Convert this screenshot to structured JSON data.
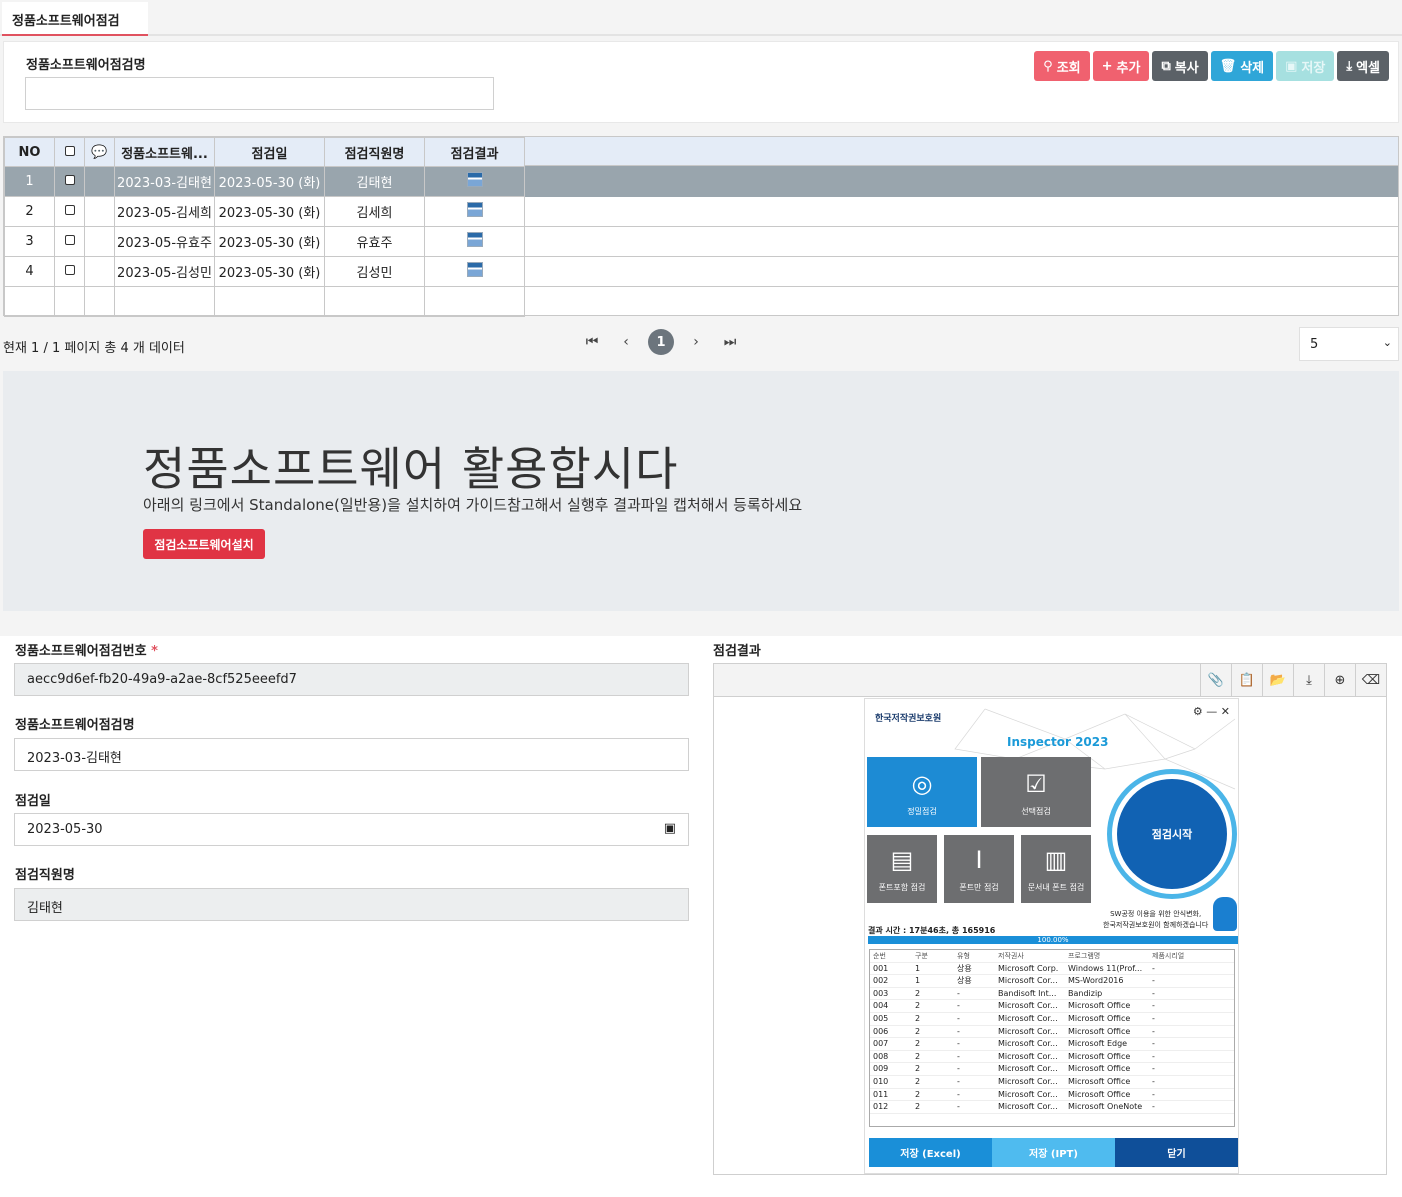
{
  "tab": {
    "label": "정품소프트웨어점검"
  },
  "search": {
    "label": "정품소프트웨어점검명",
    "value": ""
  },
  "toolbar": {
    "search": "조회",
    "add": "추가",
    "copy": "복사",
    "delete": "삭제",
    "save": "저장",
    "excel": "엑셀"
  },
  "grid": {
    "headers": [
      "NO",
      "",
      "",
      "정품소프트웨...",
      "점검일",
      "점검직원명",
      "점검결과"
    ],
    "rows": [
      {
        "no": "1",
        "name": "2023-03-김태현",
        "date": "2023-05-30 (화)",
        "staff": "김태현"
      },
      {
        "no": "2",
        "name": "2023-05-김세희",
        "date": "2023-05-30 (화)",
        "staff": "김세희"
      },
      {
        "no": "3",
        "name": "2023-05-유효주",
        "date": "2023-05-30 (화)",
        "staff": "유효주"
      },
      {
        "no": "4",
        "name": "2023-05-김성민",
        "date": "2023-05-30 (화)",
        "staff": "김성민"
      }
    ]
  },
  "paging": {
    "info": "현재 1 / 1 페이지 총 4 개 데이터",
    "current": "1",
    "page_size": "5"
  },
  "hero": {
    "title": "정품소프트웨어 활용합시다",
    "subtitle": "아래의 링크에서 Standalone(일반용)을 설치하여 가이드참고해서 실행후 결과파일 캡처해서 등록하세요",
    "button": "점검소프트웨어설치"
  },
  "form": {
    "id_label": "정품소프트웨어점검번호",
    "id_value": "aecc9d6ef-fb20-49a9-a2ae-8cf525eeefd7",
    "name_label": "정품소프트웨어점검명",
    "name_value": "2023-03-김태현",
    "date_label": "점검일",
    "date_value": "2023-05-30",
    "staff_label": "점검직원명",
    "staff_value": "김태현",
    "result_label": "점검결과"
  },
  "inspector": {
    "org": "한국저작권보호원",
    "product": "Inspector 2023",
    "tiles": [
      "정밀점검",
      "선택점검",
      "폰트포함 점검",
      "폰트만 점검",
      "문서내 폰트 점검"
    ],
    "start": "점검시작",
    "result_time": "결과 시간 : 17분46초, 총 165916",
    "message_line1": "SW공정 이용을 위한 안식변화,",
    "message_line2": "한국저작권보호원이 함께하겠습니다",
    "progress": "100.00%",
    "columns": [
      "순번",
      "구분",
      "유형",
      "저작권사",
      "프로그램명",
      "제품시리얼"
    ],
    "rows": [
      [
        "001",
        "1",
        "상용",
        "Microsoft Corp.",
        "Windows 11(Prof...",
        "-"
      ],
      [
        "002",
        "1",
        "상용",
        "Microsoft Cor...",
        "MS-Word2016",
        "-"
      ],
      [
        "003",
        "2",
        "-",
        "Bandisoft Int...",
        "Bandizip",
        "-"
      ],
      [
        "004",
        "2",
        "-",
        "Microsoft Cor...",
        "Microsoft Office",
        "-"
      ],
      [
        "005",
        "2",
        "-",
        "Microsoft Cor...",
        "Microsoft Office",
        "-"
      ],
      [
        "006",
        "2",
        "-",
        "Microsoft Cor...",
        "Microsoft Office",
        "-"
      ],
      [
        "007",
        "2",
        "-",
        "Microsoft Cor...",
        "Microsoft Edge",
        "-"
      ],
      [
        "008",
        "2",
        "-",
        "Microsoft Cor...",
        "Microsoft Office",
        "-"
      ],
      [
        "009",
        "2",
        "-",
        "Microsoft Cor...",
        "Microsoft Office",
        "-"
      ],
      [
        "010",
        "2",
        "-",
        "Microsoft Cor...",
        "Microsoft Office",
        "-"
      ],
      [
        "011",
        "2",
        "-",
        "Microsoft Cor...",
        "Microsoft Office",
        "-"
      ],
      [
        "012",
        "2",
        "-",
        "Microsoft Cor...",
        "Microsoft OneNote",
        "-"
      ]
    ],
    "buttons": [
      "저장 (Excel)",
      "저장 (IPT)",
      "닫기"
    ]
  },
  "colors": {
    "accent": "#f0616f",
    "selected_row": "#99a5ad",
    "header": "#e4ecf7",
    "hero_button": "#e03444"
  }
}
